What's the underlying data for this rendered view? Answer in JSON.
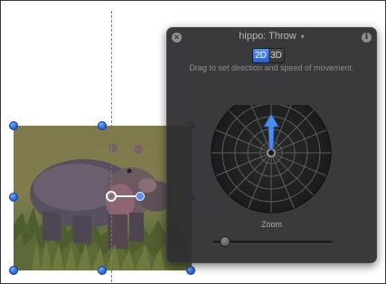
{
  "hud": {
    "title": "hippo: Throw",
    "title_caret": "▾",
    "close_glyph": "×",
    "info_glyph": "i",
    "mode_2d": "2D",
    "mode_3d": "3D",
    "selected_mode": "2D",
    "hint": "Drag to set direction and speed of movement.",
    "zoom_label": "Zoom",
    "zoom_fraction": 0.1,
    "direction_deg": 0
  },
  "icons": {
    "close": "close-icon",
    "info": "info-icon",
    "caret": "chevron-down-icon",
    "arrow": "direction-arrow-icon"
  },
  "colors": {
    "handle": "#2d6ee6",
    "guide": "#d9534f",
    "accent": "#2a62c7",
    "hud_bg": "#2e2e30"
  },
  "canvas": {
    "image_subject": "hippo"
  }
}
